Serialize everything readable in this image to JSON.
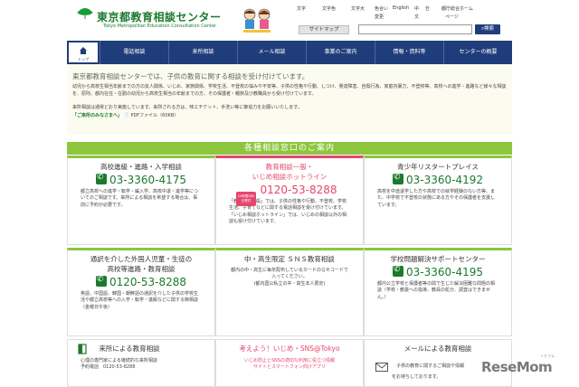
{
  "header": {
    "title": "東京都教育相談センター",
    "subtitle": "Tokyo Metropolitan Education Consultation Center",
    "utility": [
      {
        "key": "u1",
        "label": "文字"
      },
      {
        "key": "u2",
        "label": "文字色"
      },
      {
        "key": "u3",
        "label": "文字大"
      },
      {
        "key": "u4",
        "label": "色合い"
      },
      {
        "key": "u5",
        "label": "English"
      },
      {
        "key": "u6",
        "label": "中"
      },
      {
        "key": "u7",
        "label": "한"
      },
      {
        "key": "u8",
        "label": "都庁総合ホーム"
      },
      {
        "key": "u9",
        "label": "変更"
      },
      {
        "key": "u10",
        "label": "文"
      },
      {
        "key": "u11",
        "label": "ページ"
      }
    ],
    "sitemap_label": "サイトマップ",
    "search_placeholder": "",
    "search_button": "検索"
  },
  "nav": {
    "home_label": "トップ",
    "items": [
      "電話相談",
      "来所相談",
      "メール相談",
      "事業のご案内",
      "情報・資料等",
      "センターの概要"
    ]
  },
  "intro": {
    "title": "東京都教育相談センターでは、子供の教育に関する相談を受け付けています。",
    "body": "幼児から高校生相当年齢までの方の友人関係、いじめ、家族関係、学校生活、不登校の悩みや不安等、子供の性格や行動、しつけ、発達障害、自傷行為、家庭内暴力、不登校等、高校への進学・進路など様々な相談を、原則、都内在住・在勤の幼児から高校生相当の年齢までの方、その保護者・親族及び教職員から受け付けています。",
    "note": "来所相談は通常どおり実施しています。来所される方は、咳エチケット、手洗い等に御協力をお願いいたします。",
    "link": "「ご来所のみなさまへ」",
    "link_suffix": "PDFファイル（60KB）"
  },
  "section_title": "各種相談窓口のご案内",
  "cards": {
    "c1": {
      "title": "高校進級・進路・入学相談",
      "phone": "03-3360-4175",
      "text": "都立高校への進学・転学・編入学、高校中退・進学等についてのご相談です。来所による相談を希望する場合は、事前に予約が必要です。"
    },
    "c2": {
      "title1": "教育相談一般・",
      "title2": "いじめ相談ホットライン",
      "badge": "24時間365日受付",
      "phone": "0120-53-8288",
      "text": "「教育相談一般」では、子供の性格や行動、不登校、学校生活、子育てなどに関する電話相談を受け付けています。「いじめ相談ホットライン」では、いじめの相談以外の相談も受け付けています。"
    },
    "c3": {
      "title": "青少年リスタートプレイス",
      "phone": "03-3360-4192",
      "text": "高校を中途退学した方や高校での就学経験のない方等、また、中学校で不登校の状態にある方やその保護者を支援しています。"
    },
    "c4": {
      "title1": "通訳を介した外国人児童・生徒の",
      "title2": "高校等進路・教育相談",
      "phone": "0120-53-8288",
      "text": "英語、中国語、韓国・朝鮮語の通訳を介した子供の学校生活や都立高校等への入学・転学・進級などに関する御相談（金曜日午後）"
    },
    "c5": {
      "title": "中・高生限定 ＳＮＳ教育相談",
      "text1": "都内の中・高生に毎年配布しているカードのＱＲコードで入ってください。",
      "text2": "(都内国公私立の中・高生本人限定)"
    },
    "c6": {
      "title": "学校問題解決サポートセンター",
      "phone": "03-3360-4195",
      "text": "都内公立学校と保護者等の間で生じた解決困難な問題の相談（学校・教委への指導、教員の処分、調査はできません。）"
    },
    "c7": {
      "title": "来所による教育相談",
      "text1": "心理の専門家による継続的な来所相談",
      "text2": "予約電話　0120-53-8288"
    },
    "c8": {
      "title": "考えよう！いじめ・SNS@Tokyo",
      "text1": "いじめ防止とSNSの適切な利用に役立つ情報",
      "text2": "サイトとスマートフォン向けアプリ"
    },
    "c9": {
      "title": "メールによる教育相談",
      "text1": "子供の教育に関するご相談や情報",
      "text2": "をお待ちしております。"
    }
  },
  "watermark": {
    "brand": "ReseMom",
    "small": "リセマム"
  },
  "colors": {
    "navy": "#1f3d7a",
    "green": "#8cc63f",
    "brand_green": "#1a7a2e",
    "pink": "#e6466e"
  }
}
